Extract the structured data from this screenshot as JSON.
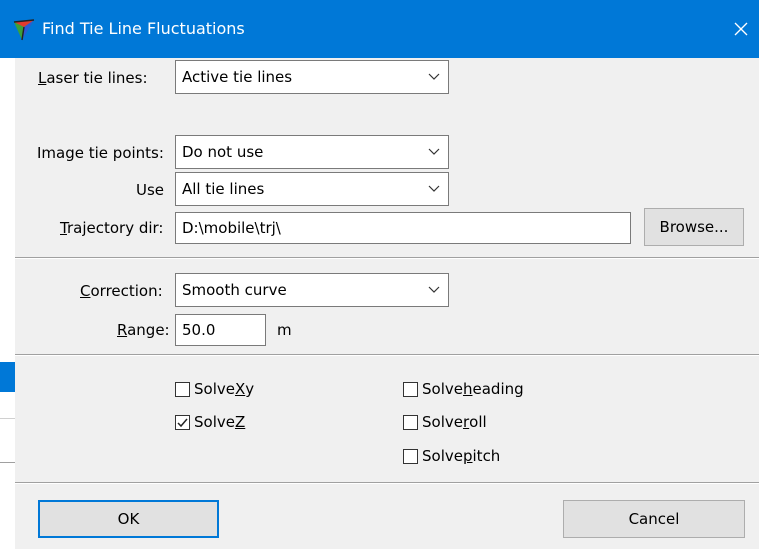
{
  "window": {
    "title": "Find Tie Line Fluctuations"
  },
  "laser": {
    "label_pre": "",
    "label_ul": "L",
    "label_post": "aser tie lines:",
    "value": "Active tie lines"
  },
  "image": {
    "label": "Image tie points:",
    "value": "Do not use"
  },
  "use": {
    "label": "Use",
    "value": "All tie lines"
  },
  "trajectory": {
    "label_ul": "T",
    "label_post": "rajectory dir:",
    "value": "D:\\mobile\\trj\\",
    "browse_label": "Browse..."
  },
  "correction": {
    "label_ul": "C",
    "label_post": "orrection:",
    "value": "Smooth curve"
  },
  "range": {
    "label_ul": "R",
    "label_post": "ange:",
    "value": "50.0",
    "unit": "m"
  },
  "solve": {
    "xy": {
      "pre": "Solve ",
      "ul": "X",
      "post": "y",
      "checked": false
    },
    "z": {
      "pre": "Solve ",
      "ul": "Z",
      "post": "",
      "checked": true
    },
    "heading": {
      "pre": "Solve ",
      "ul": "h",
      "post": "eading",
      "checked": false
    },
    "roll": {
      "pre": "Solve ",
      "ul": "r",
      "post": "oll",
      "checked": false
    },
    "pitch": {
      "pre": "Solve ",
      "ul": "p",
      "post": "itch",
      "checked": false
    }
  },
  "buttons": {
    "ok": "OK",
    "cancel": "Cancel"
  },
  "colors": {
    "accent": "#0078d7",
    "background": "#f0f0f0"
  },
  "icons": {
    "app": "tie-line-app-icon",
    "close": "close-icon",
    "dropdown": "chevron-down-icon",
    "check": "checkmark-icon"
  }
}
